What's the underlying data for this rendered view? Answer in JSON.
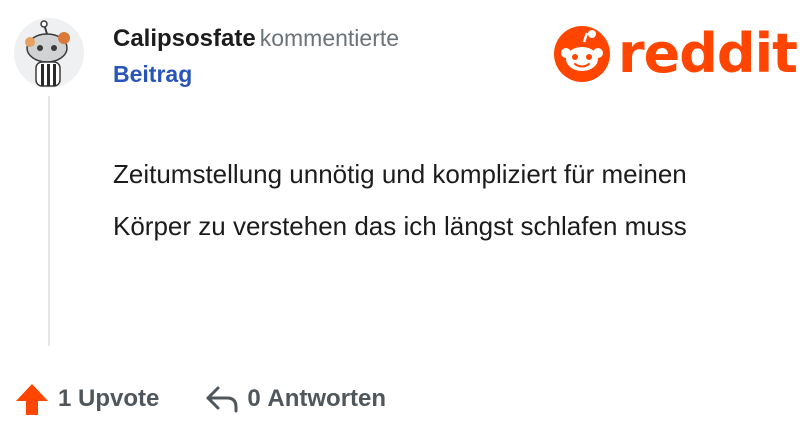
{
  "comment": {
    "username": "Calipsosfate",
    "action_text": "kommentierte",
    "target_link": "Beitrag",
    "body": "Zeitumstellung unnötig und kompliziert für meinen Körper zu verstehen das ich längst schlafen muss"
  },
  "actions": {
    "upvote_count": "1",
    "upvote_label": "Upvote",
    "reply_count": "0",
    "reply_label": "Antworten"
  },
  "branding": {
    "logo_text": "reddit",
    "logo_icon": "reddit-snoo-icon",
    "accent_color": "#ff4500"
  },
  "icons": {
    "upvote": "arrow-up-icon",
    "reply": "reply-arrow-icon"
  },
  "colors": {
    "username": "#1c1c1c",
    "link": "#2a55b8",
    "muted": "#6b7278"
  }
}
